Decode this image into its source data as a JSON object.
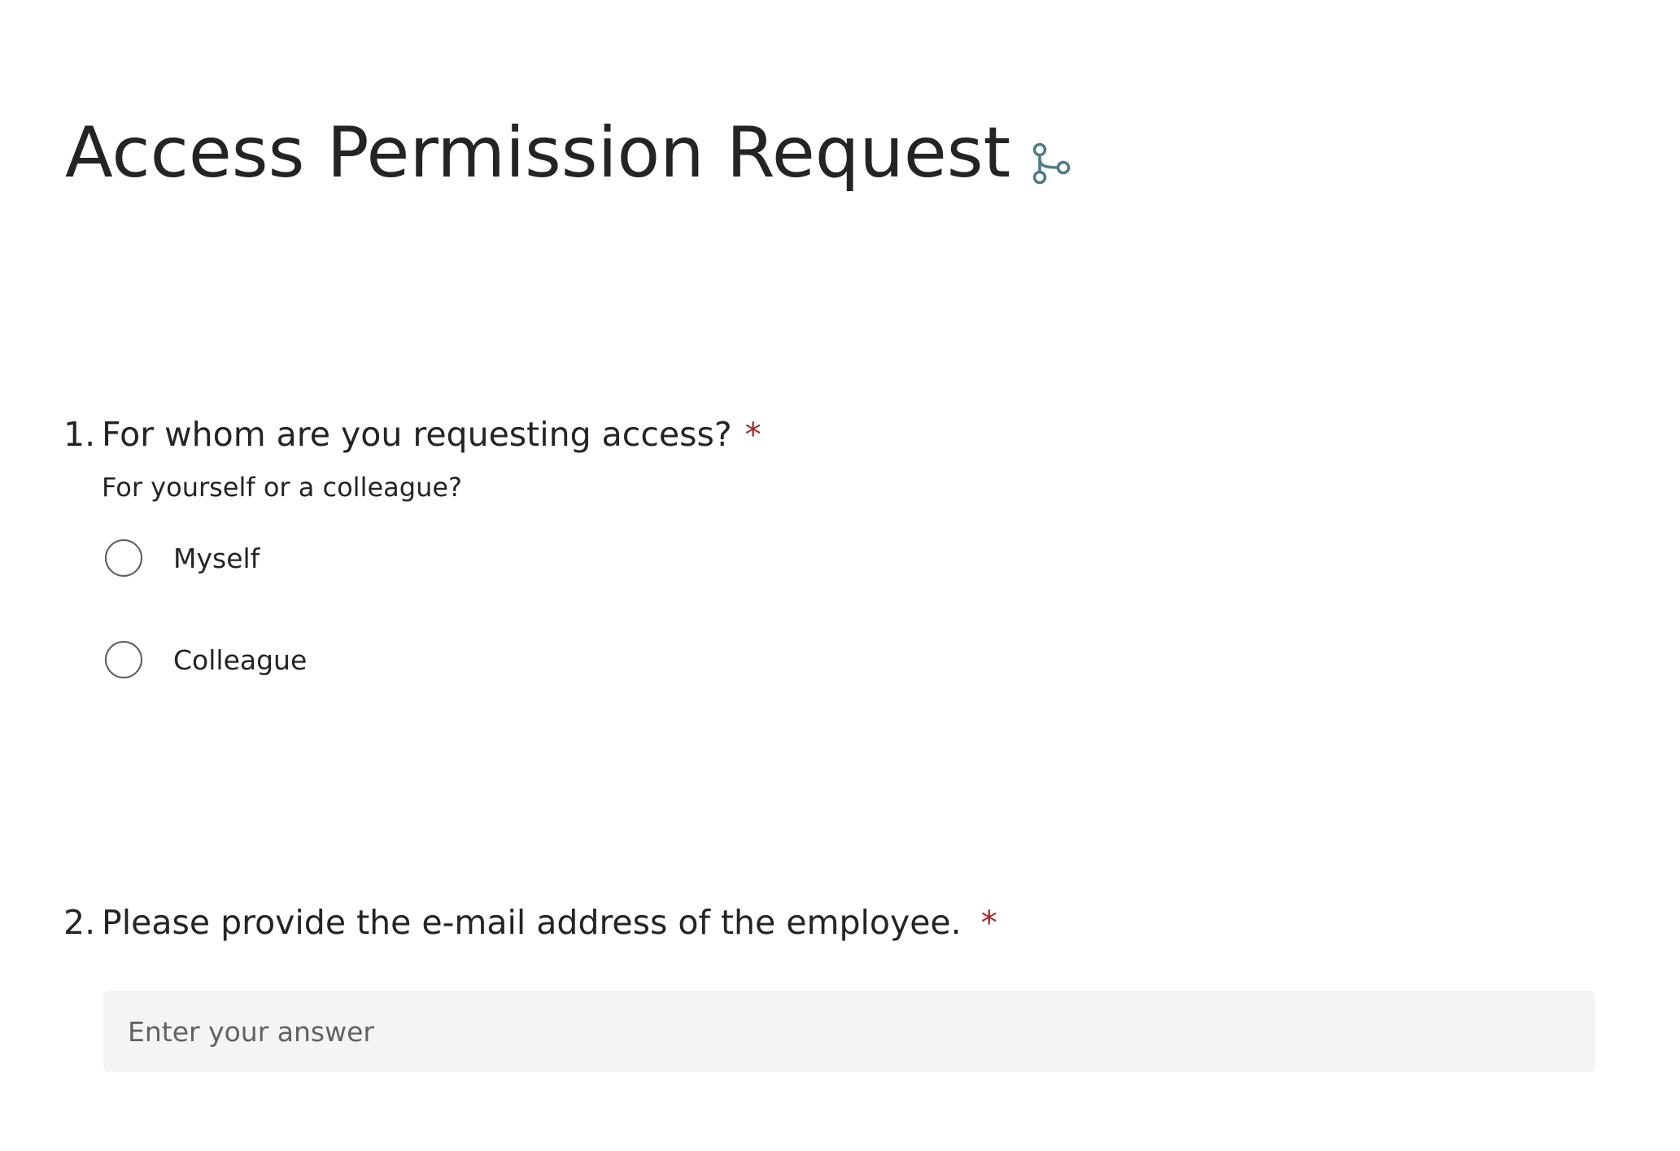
{
  "form": {
    "title": "Access Permission Request",
    "title_icon": "branching-icon",
    "accent_color": "#4e7d84",
    "required_color": "#a4262c"
  },
  "questions": [
    {
      "number": "1.",
      "title": "For whom are you requesting access?",
      "required_mark": "*",
      "subtitle": "For yourself or a colleague?",
      "type": "radio",
      "options": [
        "Myself",
        "Colleague"
      ],
      "selected": null
    },
    {
      "number": "2.",
      "title": "Please provide the e-mail address of the employee.",
      "required_mark": "*",
      "type": "text",
      "value": "",
      "placeholder": "Enter your answer"
    }
  ]
}
